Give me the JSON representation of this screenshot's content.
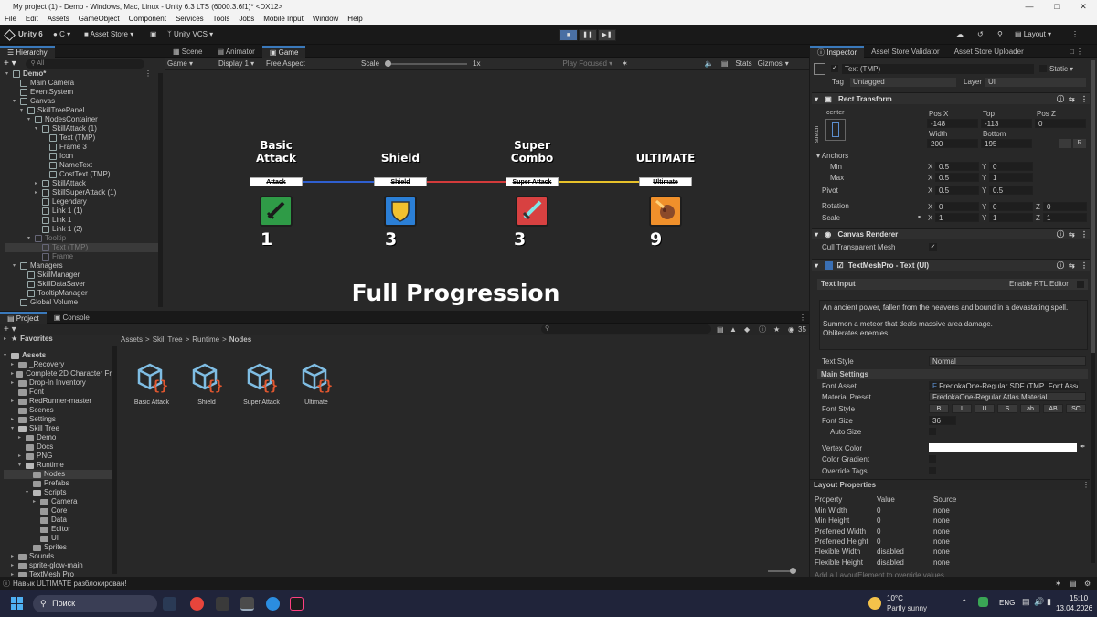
{
  "window": {
    "title": "My project (1) - Demo - Windows, Mac, Linux - Unity 6.3 LTS (6000.3.6f1)* <DX12>"
  },
  "menu": [
    "File",
    "Edit",
    "Assets",
    "GameObject",
    "Component",
    "Services",
    "Tools",
    "Jobs",
    "Mobile Input",
    "Window",
    "Help"
  ],
  "toolbar": {
    "account": "Unity 6",
    "cloud": "C",
    "asset_store": "Asset Store",
    "vcs": "Unity VCS",
    "layout": "Layout"
  },
  "hierarchy": {
    "tab": "Hierarchy",
    "search": "All",
    "items": [
      {
        "label": "Demo*",
        "depth": 0
      },
      {
        "label": "Main Camera",
        "depth": 1
      },
      {
        "label": "EventSystem",
        "depth": 1
      },
      {
        "label": "Canvas",
        "depth": 1
      },
      {
        "label": "SkillTreePanel",
        "depth": 2
      },
      {
        "label": "NodesContainer",
        "depth": 3
      },
      {
        "label": "SkillAttack (1)",
        "depth": 4
      },
      {
        "label": "Text (TMP)",
        "depth": 5
      },
      {
        "label": "Frame 3",
        "depth": 5
      },
      {
        "label": "Icon",
        "depth": 5
      },
      {
        "label": "NameText",
        "depth": 5
      },
      {
        "label": "CostText (TMP)",
        "depth": 5
      },
      {
        "label": "SkillAttack",
        "depth": 4
      },
      {
        "label": "SkillSuperAttack (1)",
        "depth": 4
      },
      {
        "label": "Legendary",
        "depth": 4
      },
      {
        "label": "Link 1 (1)",
        "depth": 4
      },
      {
        "label": "Link 1",
        "depth": 4
      },
      {
        "label": "Link 1 (2)",
        "depth": 4
      },
      {
        "label": "Tooltip",
        "depth": 3
      },
      {
        "label": "Text (TMP)",
        "depth": 4
      },
      {
        "label": "Frame",
        "depth": 4
      },
      {
        "label": "Managers",
        "depth": 1
      },
      {
        "label": "SkillManager",
        "depth": 2
      },
      {
        "label": "SkillDataSaver",
        "depth": 2
      },
      {
        "label": "TooltipManager",
        "depth": 2
      },
      {
        "label": "Global Volume",
        "depth": 1
      }
    ]
  },
  "scene_tabs": [
    "Scene",
    "Animator",
    "Game"
  ],
  "game_bar": {
    "mode": "Game",
    "display": "Display 1",
    "aspect": "Free Aspect",
    "scale_label": "Scale",
    "scale_value": "1x",
    "play_focused": "Play Focused",
    "stats": "Stats",
    "gizmos": "Gizmos"
  },
  "game": {
    "background": "#2c4a78",
    "nodes": [
      {
        "title_line1": "Basic",
        "title_line2": "Attack",
        "label": "Attack",
        "cost": "1",
        "icon": "sword-icon",
        "color": "#2f9b47"
      },
      {
        "title_line1": "",
        "title_line2": "Shield",
        "label": "Shield",
        "cost": "3",
        "icon": "shield-icon",
        "color": "#2b7fd6"
      },
      {
        "title_line1": "Super",
        "title_line2": "Combo",
        "label": "Super Attack",
        "cost": "3",
        "icon": "blade-icon",
        "color": "#d84141"
      },
      {
        "title_line1": "",
        "title_line2": "ULTIMATE",
        "label": "Ultimate",
        "cost": "9",
        "icon": "meteor-icon",
        "color": "#f0902b"
      }
    ],
    "link_colors": [
      "#2f5fd0",
      "#d43b3b",
      "#e8c22a"
    ],
    "footer": "Full Progression"
  },
  "project": {
    "tabs": [
      "Project",
      "Console"
    ],
    "count": "35",
    "breadcrumb": [
      "Assets",
      "Skill Tree",
      "Runtime",
      "Nodes"
    ],
    "favorites": "Favorites",
    "tree": [
      {
        "label": "Assets",
        "depth": 0
      },
      {
        "label": "_Recovery",
        "depth": 1
      },
      {
        "label": "Complete 2D Character Fr",
        "depth": 1
      },
      {
        "label": "Drop-In Inventory",
        "depth": 1
      },
      {
        "label": "Font",
        "depth": 1
      },
      {
        "label": "RedRunner-master",
        "depth": 1
      },
      {
        "label": "Scenes",
        "depth": 1
      },
      {
        "label": "Settings",
        "depth": 1
      },
      {
        "label": "Skill Tree",
        "depth": 1
      },
      {
        "label": "Demo",
        "depth": 2
      },
      {
        "label": "Docs",
        "depth": 2
      },
      {
        "label": "PNG",
        "depth": 2
      },
      {
        "label": "Runtime",
        "depth": 2
      },
      {
        "label": "Nodes",
        "depth": 3
      },
      {
        "label": "Prefabs",
        "depth": 3
      },
      {
        "label": "Scripts",
        "depth": 3
      },
      {
        "label": "Camera",
        "depth": 4
      },
      {
        "label": "Core",
        "depth": 4
      },
      {
        "label": "Data",
        "depth": 4
      },
      {
        "label": "Editor",
        "depth": 4
      },
      {
        "label": "UI",
        "depth": 4
      },
      {
        "label": "Sprites",
        "depth": 3
      },
      {
        "label": "Sounds",
        "depth": 1
      },
      {
        "label": "sprite-glow-main",
        "depth": 1
      },
      {
        "label": "TextMesh Pro",
        "depth": 1
      }
    ],
    "assets": [
      "Basic Attack",
      "Shield",
      "Super Attack",
      "Ultimate"
    ]
  },
  "status": {
    "message": "Навык ULTIMATE разблокирован!"
  },
  "inspector": {
    "tabs": [
      "Inspector",
      "Asset Store Validator",
      "Asset Store Uploader"
    ],
    "object_name": "Text (TMP)",
    "static": "Static",
    "tag_label": "Tag",
    "tag": "Untagged",
    "layer_label": "Layer",
    "layer": "UI",
    "rect": {
      "header": "Rect Transform",
      "anchor_h": "center",
      "anchor_v": "stretch",
      "posx_l": "Pos X",
      "posx": "-148",
      "top_l": "Top",
      "top": "-113",
      "posz_l": "Pos Z",
      "posz": "0",
      "width_l": "Width",
      "width": "200",
      "bottom_l": "Bottom",
      "bottom": "195",
      "anchors": "Anchors",
      "min": "Min",
      "max": "Max",
      "min_x": "0.5",
      "min_y": "0",
      "max_x": "0.5",
      "max_y": "1",
      "pivot": "Pivot",
      "pivot_x": "0.5",
      "pivot_y": "0.5",
      "rotation": "Rotation",
      "rot_x": "0",
      "rot_y": "0",
      "rot_z": "0",
      "scale": "Scale",
      "scale_x": "1",
      "scale_y": "1",
      "scale_z": "1"
    },
    "canvas_renderer": {
      "header": "Canvas Renderer",
      "cull": "Cull Transparent Mesh"
    },
    "tmp": {
      "header": "TextMeshPro - Text (UI)",
      "text_input": "Text Input",
      "rtl": "Enable RTL Editor",
      "text_line1": "An ancient power, fallen from the heavens and bound in a devastating spell.",
      "text_line2": "Summon a meteor that deals massive area damage.",
      "text_line3": "Obliterates enemies.",
      "text_style_l": "Text Style",
      "text_style": "Normal",
      "main_settings": "Main Settings",
      "font_asset_l": "Font Asset",
      "font_asset": "FredokaOne-Regular SDF (TMP_Font Asset",
      "material_l": "Material Preset",
      "material": "FredokaOne-Regular Atlas Material",
      "font_style_l": "Font Style",
      "font_styles": [
        "B",
        "I",
        "U",
        "S",
        "ab",
        "AB",
        "SC"
      ],
      "font_size_l": "Font Size",
      "font_size": "36",
      "auto_size": "Auto Size",
      "vertex_color": "Vertex Color",
      "color_gradient": "Color Gradient",
      "override_tags": "Override Tags"
    },
    "layout": {
      "header": "Layout Properties",
      "cols": [
        "Property",
        "Value",
        "Source"
      ],
      "rows": [
        [
          "Min Width",
          "0",
          "none"
        ],
        [
          "Min Height",
          "0",
          "none"
        ],
        [
          "Preferred Width",
          "0",
          "none"
        ],
        [
          "Preferred Height",
          "0",
          "none"
        ],
        [
          "Flexible Width",
          "disabled",
          "none"
        ],
        [
          "Flexible Height",
          "disabled",
          "none"
        ]
      ],
      "hint": "Add a LayoutElement to override values"
    }
  },
  "taskbar": {
    "search": "Поиск",
    "weather_temp": "10°C",
    "weather_desc": "Partly sunny",
    "lang": "ENG",
    "time": "15:10",
    "date": "13.04.2026"
  }
}
